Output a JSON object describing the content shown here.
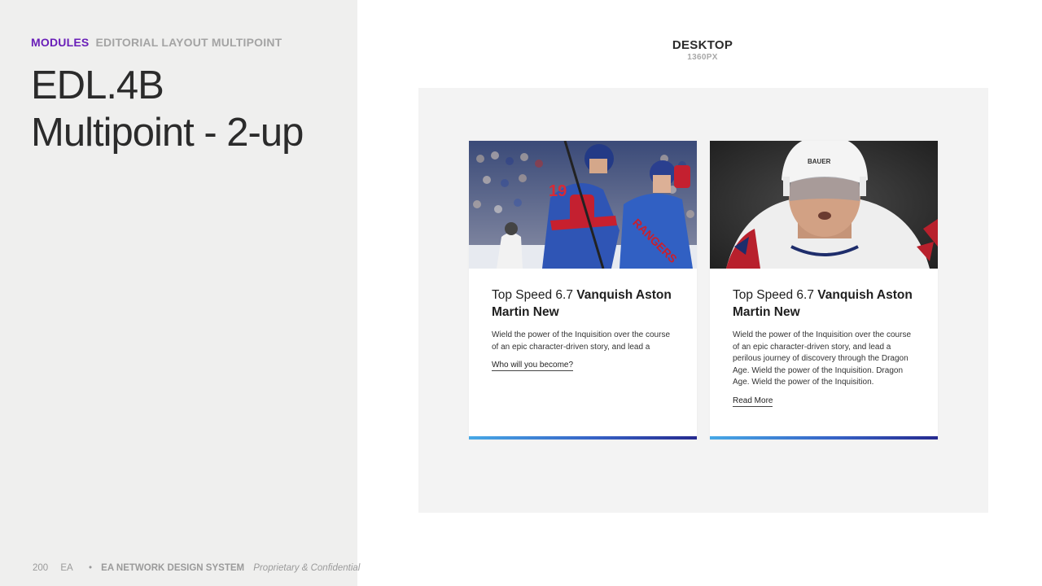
{
  "header": {
    "category": "MODULES",
    "subcategory": "EDITORIAL LAYOUT MULTIPOINT",
    "title_line1": "EDL.4B",
    "title_line2": "Multipoint - 2-up"
  },
  "viewport": {
    "name": "DESKTOP",
    "size": "1360PX"
  },
  "cards": [
    {
      "title_light": "Top Speed 6.7 ",
      "title_bold": "Vanquish Aston Martin New",
      "description": "Wield the power of the Inquisition over the course of an epic character-driven story, and lead a",
      "link": "Who will you become?",
      "image": "hockey-celebration-image"
    },
    {
      "title_light": "Top Speed 6.7 ",
      "title_bold": "Vanquish Aston Martin New",
      "description": "Wield the power of the Inquisition over the course of an epic character-driven story, and lead a perilous journey of discovery through the Dragon Age. Wield the power of the Inquisition. Dragon Age. Wield the power of the Inquisition.",
      "link": "Read More",
      "image": "hockey-player-helmet-image"
    }
  ],
  "footer": {
    "page_number": "200",
    "brand": "EA",
    "system": "EA NETWORK DESIGN SYSTEM",
    "notice": "Proprietary & Confidential"
  },
  "colors": {
    "accent_purple": "#6a1fb8",
    "panel_bg": "#efefee",
    "canvas_bg": "#f3f3f3",
    "bar_start": "#47a8e6",
    "bar_end": "#262a8f"
  }
}
